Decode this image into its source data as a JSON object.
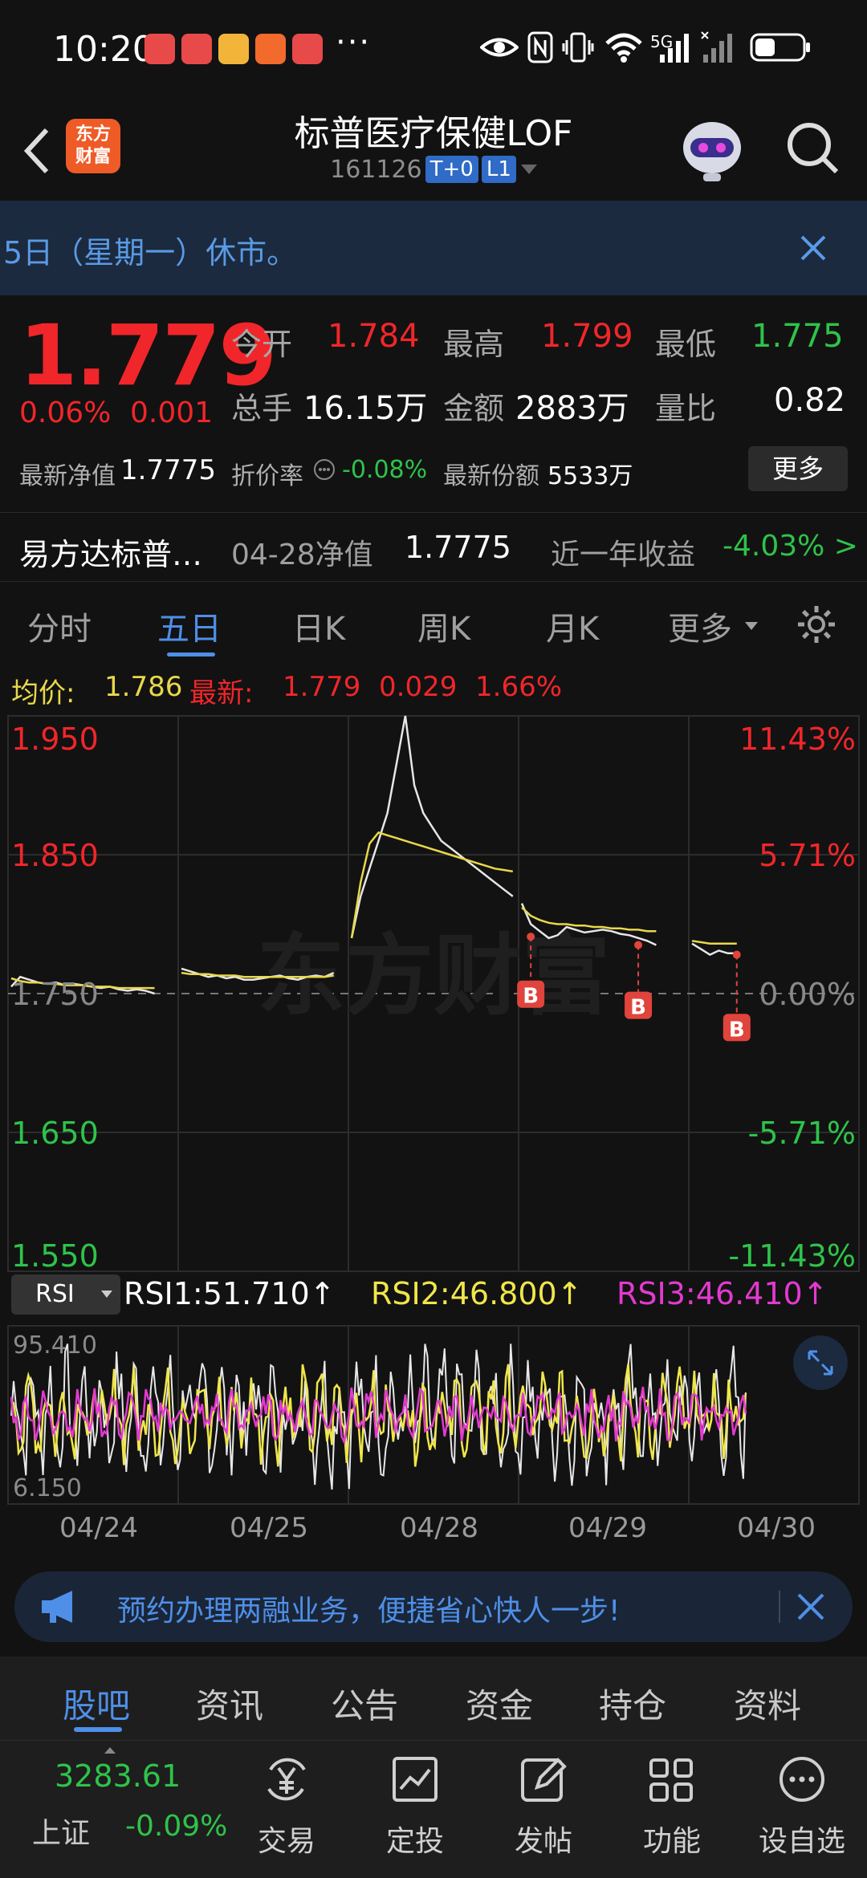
{
  "status_bar": {
    "time": "10:20",
    "more_apps": "···",
    "network": "5G"
  },
  "header": {
    "brand_line1": "东方",
    "brand_line2": "财富",
    "title": "标普医疗保健LOF",
    "code": "161126",
    "tag_t0": "T+0",
    "tag_l1": "L1"
  },
  "notice": {
    "text": "5日（星期一）休市。"
  },
  "quote": {
    "price": "1.779",
    "change_pct": "0.06%",
    "change_abs": "0.001",
    "open_label": "今开",
    "open_value": "1.784",
    "high_label": "最高",
    "high_value": "1.799",
    "low_label": "最低",
    "low_value": "1.775",
    "volume_label": "总手",
    "volume_value": "16.15万",
    "amount_label": "金额",
    "amount_value": "2883万",
    "ratio_label": "量比",
    "ratio_value": "0.82",
    "nav_label": "最新净值",
    "nav_value": "1.7775",
    "discount_label": "折价率",
    "discount_value": "-0.08%",
    "shares_label": "最新份额",
    "shares_value": "5533万",
    "more_button": "更多",
    "fund_name": "易方达标普…",
    "nav_date_label": "04-28净值",
    "nav_date_value": "1.7775",
    "year_return_label": "近一年收益",
    "year_return_value": "-4.03% >"
  },
  "tabs": [
    "分时",
    "五日",
    "日K",
    "周K",
    "月K",
    "更多"
  ],
  "chart_header": {
    "avg_label": "均价:",
    "avg_value": "1.786",
    "latest_label": "最新:",
    "latest_value": "1.779",
    "latest_change": "0.029",
    "latest_pct": "1.66%"
  },
  "chart_data": {
    "type": "line",
    "title": "",
    "x_labels": [
      "04/24",
      "04/25",
      "04/28",
      "04/29",
      "04/30"
    ],
    "price_ticks": [
      "1.950",
      "1.850",
      "1.750",
      "1.650",
      "1.550"
    ],
    "pct_ticks": [
      "11.43%",
      "5.71%",
      "0.00%",
      "-5.71%",
      "-11.43%"
    ],
    "ylim": [
      1.55,
      1.95
    ],
    "prev_close": 1.75,
    "colors": {
      "price": "#e6e6e6",
      "avg": "#e8d84a",
      "up": "#f0262a",
      "down": "#2ec34a",
      "marker": "#e0443c"
    },
    "series": [
      {
        "name": "最新",
        "values": [
          1.755,
          1.762,
          1.76,
          1.758,
          1.757,
          1.758,
          1.756,
          1.757,
          1.756,
          1.755,
          1.754,
          1.755,
          1.753,
          1.752,
          1.753,
          1.752,
          1.75,
          1.768,
          1.766,
          1.764,
          1.762,
          1.763,
          1.761,
          1.762,
          1.76,
          1.76,
          1.761,
          1.762,
          1.763,
          1.761,
          1.76,
          1.762,
          1.763,
          1.762,
          1.765,
          1.79,
          1.82,
          1.84,
          1.86,
          1.88,
          1.915,
          1.95,
          1.9,
          1.88,
          1.87,
          1.86,
          1.855,
          1.85,
          1.845,
          1.84,
          1.835,
          1.83,
          1.825,
          1.82,
          1.815,
          1.8,
          1.795,
          1.79,
          1.792,
          1.798,
          1.796,
          1.794,
          1.795,
          1.796,
          1.795,
          1.793,
          1.792,
          1.79,
          1.788,
          1.785,
          1.786,
          1.782,
          1.778,
          1.781,
          1.779,
          1.779
        ]
      },
      {
        "name": "均价",
        "values": [
          1.761,
          1.759,
          1.758,
          1.758,
          1.757,
          1.757,
          1.756,
          1.756,
          1.756,
          1.755,
          1.755,
          1.755,
          1.754,
          1.754,
          1.754,
          1.754,
          1.754,
          1.765,
          1.764,
          1.764,
          1.764,
          1.763,
          1.763,
          1.763,
          1.762,
          1.762,
          1.762,
          1.762,
          1.762,
          1.762,
          1.762,
          1.762,
          1.762,
          1.762,
          1.763,
          1.79,
          1.83,
          1.858,
          1.866,
          1.864,
          1.862,
          1.86,
          1.858,
          1.856,
          1.854,
          1.852,
          1.85,
          1.848,
          1.846,
          1.844,
          1.842,
          1.84,
          1.839,
          1.838,
          1.812,
          1.806,
          1.803,
          1.801,
          1.8,
          1.8,
          1.799,
          1.799,
          1.798,
          1.798,
          1.797,
          1.797,
          1.796,
          1.796,
          1.795,
          1.795,
          1.788,
          1.787,
          1.786,
          1.786,
          1.786,
          1.786
        ]
      }
    ],
    "buy_markers": [
      "B",
      "B",
      "B"
    ]
  },
  "rsi": {
    "selector": "RSI",
    "rsi1": "RSI1:51.710↑",
    "rsi2": "RSI2:46.800↑",
    "rsi3": "RSI3:46.410↑",
    "max_label": "95.410",
    "min_label": "6.150",
    "colors": {
      "rsi1": "#ffffff",
      "rsi2": "#f0e64a",
      "rsi3": "#e23ad0"
    }
  },
  "promo": {
    "text": "预约办理两融业务，便捷省心快人一步!"
  },
  "bottom_tabs": [
    "股吧",
    "资讯",
    "公告",
    "资金",
    "持仓",
    "资料"
  ],
  "bottom_nav": {
    "index_value": "3283.61",
    "index_name": "上证",
    "index_change": "-0.09%",
    "items": [
      "交易",
      "定投",
      "发帖",
      "功能",
      "设自选"
    ]
  }
}
